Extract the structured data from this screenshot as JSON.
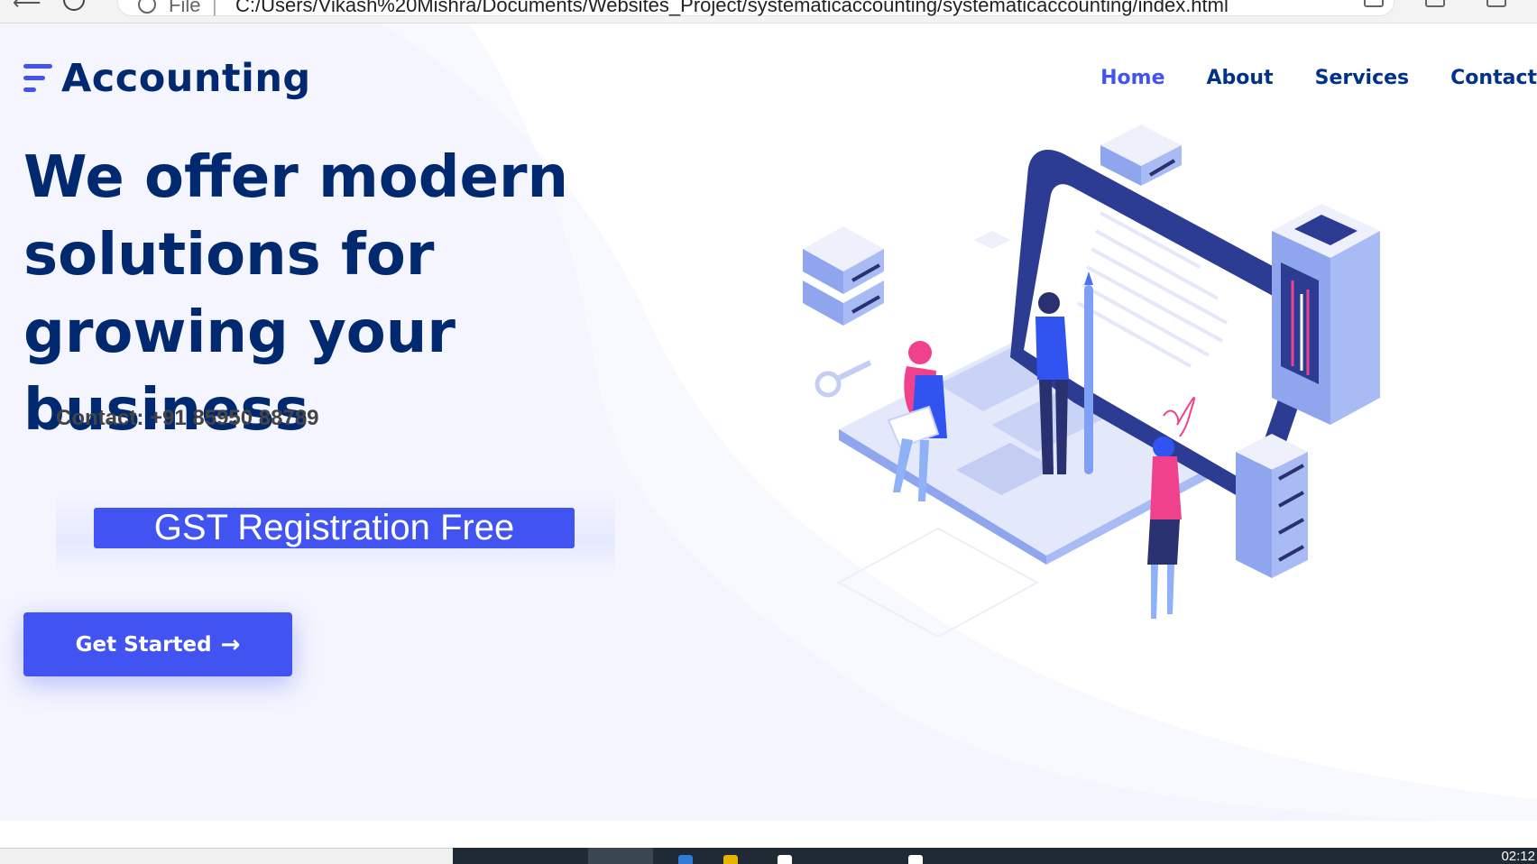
{
  "browser": {
    "scheme": "File",
    "separator": "|",
    "url": "C:/Users/Vikash%20Mishra/Documents/Websites_Project/systematicaccounting/systematicaccounting/index.html"
  },
  "header": {
    "logo_text": "Accounting",
    "nav": [
      {
        "label": "Home",
        "active": true
      },
      {
        "label": "About",
        "active": false
      },
      {
        "label": "Services",
        "active": false
      },
      {
        "label": "Contact",
        "active": false
      }
    ]
  },
  "hero": {
    "headline": "We offer modern solutions for growing your business",
    "contact": "Contact: +91 85950 88789",
    "gst_banner": "GST Registration Free",
    "cta_label": "Get Started",
    "cta_icon": "arrow-right-icon"
  },
  "taskbar": {
    "clock": "02:12"
  },
  "colors": {
    "primary": "#4154f1",
    "heading": "#012970",
    "nav": "#013289",
    "text": "#444444",
    "hero_bg": "#f4f5fe"
  }
}
